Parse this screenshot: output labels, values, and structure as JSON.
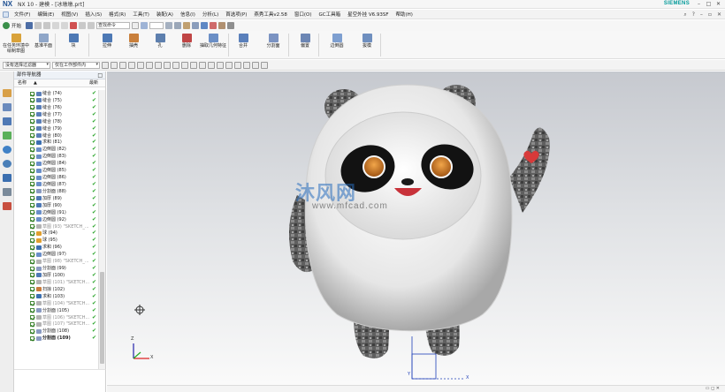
{
  "window": {
    "app_logo": "NX",
    "title": "NX 10 - 建模 - [冰墩墩.prt]",
    "brand": "SIEMENS",
    "controls": [
      "–",
      "□",
      "✕"
    ]
  },
  "menubar": {
    "items": [
      "文件(F)",
      "编辑(E)",
      "视图(V)",
      "插入(S)",
      "格式(R)",
      "工具(T)",
      "装配(A)",
      "信息(I)",
      "分析(L)",
      "首选项(P)",
      "燕秀工具v2.58",
      "窗口(O)",
      "GC工具箱",
      "星空外挂 V6.93SF",
      "帮助(H)"
    ]
  },
  "quick_toolbar": {
    "start_label": "开始",
    "search_placeholder": "查找命令",
    "view_combo": ""
  },
  "ribbon": {
    "buttons": [
      {
        "label": "在任务环境中绘制草图",
        "icon": "sketch-icon"
      },
      {
        "label": "基准平面",
        "icon": "datum-plane-icon"
      },
      {
        "label": "块",
        "icon": "block-icon"
      },
      {
        "label": "拉伸",
        "icon": "extrude-icon"
      },
      {
        "label": "抽壳",
        "icon": "shell-icon"
      },
      {
        "label": "孔",
        "icon": "hole-icon"
      },
      {
        "label": "删除",
        "icon": "delete-icon"
      },
      {
        "label": "抽取几何特征",
        "icon": "extract-geometry-icon"
      },
      {
        "label": "合并",
        "icon": "unite-icon"
      },
      {
        "label": "分割面",
        "icon": "divide-face-icon"
      },
      {
        "label": "偏置",
        "icon": "offset-icon"
      },
      {
        "label": "边倒圆",
        "icon": "edge-blend-icon"
      },
      {
        "label": "拔模",
        "icon": "draft-icon"
      }
    ]
  },
  "selection_bar": {
    "filter": "没有选择过滤器",
    "scope": "仅在工作部件内"
  },
  "navigator": {
    "title": "部件导航器",
    "col_name": "名称",
    "col_latest": "最新",
    "items": [
      {
        "label": "缝合 (74)",
        "gray": false,
        "bold": false,
        "icon": "#5b7fb8"
      },
      {
        "label": "缝合 (75)",
        "gray": false,
        "bold": false,
        "icon": "#5b7fb8"
      },
      {
        "label": "缝合 (76)",
        "gray": false,
        "bold": false,
        "icon": "#5b7fb8"
      },
      {
        "label": "缝合 (77)",
        "gray": false,
        "bold": false,
        "icon": "#5b7fb8"
      },
      {
        "label": "缝合 (78)",
        "gray": false,
        "bold": false,
        "icon": "#5b7fb8"
      },
      {
        "label": "缝合 (79)",
        "gray": false,
        "bold": false,
        "icon": "#5b7fb8"
      },
      {
        "label": "缝合 (80)",
        "gray": false,
        "bold": false,
        "icon": "#5b7fb8"
      },
      {
        "label": "求和 (81)",
        "gray": false,
        "bold": false,
        "icon": "#3b6fb0"
      },
      {
        "label": "边倒圆 (82)",
        "gray": false,
        "bold": false,
        "icon": "#6a8fc9"
      },
      {
        "label": "边倒圆 (83)",
        "gray": false,
        "bold": false,
        "icon": "#6a8fc9"
      },
      {
        "label": "边倒圆 (84)",
        "gray": false,
        "bold": false,
        "icon": "#6a8fc9"
      },
      {
        "label": "边倒圆 (85)",
        "gray": false,
        "bold": false,
        "icon": "#6a8fc9"
      },
      {
        "label": "边倒圆 (86)",
        "gray": false,
        "bold": false,
        "icon": "#6a8fc9"
      },
      {
        "label": "边倒圆 (87)",
        "gray": false,
        "bold": false,
        "icon": "#6a8fc9"
      },
      {
        "label": "分割面 (88)",
        "gray": false,
        "bold": false,
        "icon": "#8a9bc2"
      },
      {
        "label": "加厚 (89)",
        "gray": false,
        "bold": false,
        "icon": "#4f79b5"
      },
      {
        "label": "加厚 (90)",
        "gray": false,
        "bold": false,
        "icon": "#4f79b5"
      },
      {
        "label": "边倒圆 (91)",
        "gray": false,
        "bold": false,
        "icon": "#6a8fc9"
      },
      {
        "label": "边倒圆 (92)",
        "gray": false,
        "bold": false,
        "icon": "#6a8fc9"
      },
      {
        "label": "草图 (93) \"SKETCH_...",
        "gray": true,
        "bold": false,
        "icon": "#b4b4b4"
      },
      {
        "label": "球 (94)",
        "gray": false,
        "bold": false,
        "icon": "#e0a030"
      },
      {
        "label": "球 (95)",
        "gray": false,
        "bold": false,
        "icon": "#e0a030"
      },
      {
        "label": "求和 (96)",
        "gray": false,
        "bold": false,
        "icon": "#3b6fb0"
      },
      {
        "label": "边倒圆 (97)",
        "gray": false,
        "bold": false,
        "icon": "#6a8fc9"
      },
      {
        "label": "草图 (98) \"SKETCH_...",
        "gray": true,
        "bold": false,
        "icon": "#b4b4b4"
      },
      {
        "label": "分割面 (99)",
        "gray": false,
        "bold": false,
        "icon": "#8a9bc2"
      },
      {
        "label": "加厚 (100)",
        "gray": false,
        "bold": false,
        "icon": "#4f79b5"
      },
      {
        "label": "草图 (101) \"SKETCH...",
        "gray": true,
        "bold": false,
        "icon": "#b4b4b4"
      },
      {
        "label": "扫掠 (102)",
        "gray": false,
        "bold": false,
        "icon": "#c97a3a"
      },
      {
        "label": "求和 (103)",
        "gray": false,
        "bold": false,
        "icon": "#3b6fb0"
      },
      {
        "label": "草图 (104) \"SKETCH...",
        "gray": true,
        "bold": false,
        "icon": "#b4b4b4"
      },
      {
        "label": "分割面 (105)",
        "gray": false,
        "bold": false,
        "icon": "#8a9bc2"
      },
      {
        "label": "草图 (106) \"SKETCH...",
        "gray": true,
        "bold": false,
        "icon": "#b4b4b4"
      },
      {
        "label": "草图 (107) \"SKETCH...",
        "gray": true,
        "bold": false,
        "icon": "#b4b4b4"
      },
      {
        "label": "分割面 (108)",
        "gray": false,
        "bold": false,
        "icon": "#8a9bc2"
      },
      {
        "label": "分割面 (109)",
        "gray": false,
        "bold": true,
        "icon": "#8a9bc2"
      }
    ]
  },
  "watermark": {
    "text": "沐风网",
    "sub": "www.mfcad.com"
  },
  "axes": {
    "x": "X",
    "y": "Y",
    "z": "Z"
  }
}
